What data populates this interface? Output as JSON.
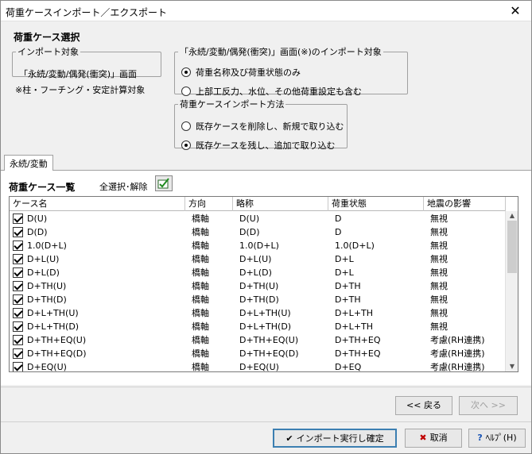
{
  "window": {
    "title": "荷重ケースインポート／エクスポート",
    "close_glyph": "✕"
  },
  "selection": {
    "title": "荷重ケース選択"
  },
  "import_target": {
    "legend": "インポート対象",
    "value": "「永続/変動/偶発(衝突)」画面",
    "note": "※柱・フーチング・安定計算対象"
  },
  "import_scope": {
    "legend": "「永続/変動/偶発(衝突)」画面(※)のインポート対象",
    "options": [
      {
        "label": "荷重名称及び荷重状態のみ",
        "selected": true
      },
      {
        "label": "上部工反力、水位、その他荷重設定も含む",
        "selected": false
      }
    ]
  },
  "import_method": {
    "legend": "荷重ケースインポート方法",
    "options": [
      {
        "label": "既存ケースを削除し、新規で取り込む",
        "selected": false
      },
      {
        "label": "既存ケースを残し、追加で取り込む",
        "selected": true
      }
    ]
  },
  "tabs": [
    {
      "label": "永続/変動",
      "active": true
    }
  ],
  "list": {
    "title": "荷重ケース一覧",
    "select_all_label": "全選択･解除",
    "columns": [
      "ケース名",
      "方向",
      "略称",
      "荷重状態",
      "地震の影響"
    ],
    "rows": [
      {
        "checked": true,
        "name": "D(U)",
        "dir": "橋軸",
        "abbr": "D(U)",
        "state": "D",
        "quake": "無視"
      },
      {
        "checked": true,
        "name": "D(D)",
        "dir": "橋軸",
        "abbr": "D(D)",
        "state": "D",
        "quake": "無視"
      },
      {
        "checked": true,
        "name": "1.0(D+L)",
        "dir": "橋軸",
        "abbr": "1.0(D+L)",
        "state": "1.0(D+L)",
        "quake": "無視"
      },
      {
        "checked": true,
        "name": "D+L(U)",
        "dir": "橋軸",
        "abbr": "D+L(U)",
        "state": "D+L",
        "quake": "無視"
      },
      {
        "checked": true,
        "name": "D+L(D)",
        "dir": "橋軸",
        "abbr": "D+L(D)",
        "state": "D+L",
        "quake": "無視"
      },
      {
        "checked": true,
        "name": "D+TH(U)",
        "dir": "橋軸",
        "abbr": "D+TH(U)",
        "state": "D+TH",
        "quake": "無視"
      },
      {
        "checked": true,
        "name": "D+TH(D)",
        "dir": "橋軸",
        "abbr": "D+TH(D)",
        "state": "D+TH",
        "quake": "無視"
      },
      {
        "checked": true,
        "name": "D+L+TH(U)",
        "dir": "橋軸",
        "abbr": "D+L+TH(U)",
        "state": "D+L+TH",
        "quake": "無視"
      },
      {
        "checked": true,
        "name": "D+L+TH(D)",
        "dir": "橋軸",
        "abbr": "D+L+TH(D)",
        "state": "D+L+TH",
        "quake": "無視"
      },
      {
        "checked": true,
        "name": "D+TH+EQ(U)",
        "dir": "橋軸",
        "abbr": "D+TH+EQ(U)",
        "state": "D+TH+EQ",
        "quake": "考慮(RH連携)"
      },
      {
        "checked": true,
        "name": "D+TH+EQ(D)",
        "dir": "橋軸",
        "abbr": "D+TH+EQ(D)",
        "state": "D+TH+EQ",
        "quake": "考慮(RH連携)"
      },
      {
        "checked": true,
        "name": "D+EQ(U)",
        "dir": "橋軸",
        "abbr": "D+EQ(U)",
        "state": "D+EQ",
        "quake": "考慮(RH連携)"
      }
    ]
  },
  "nav": {
    "back": "<< 戻る",
    "next": "次へ >>"
  },
  "actions": {
    "import": "インポート実行し確定",
    "cancel": "取消",
    "help": "ﾍﾙﾌﾟ(H)"
  }
}
